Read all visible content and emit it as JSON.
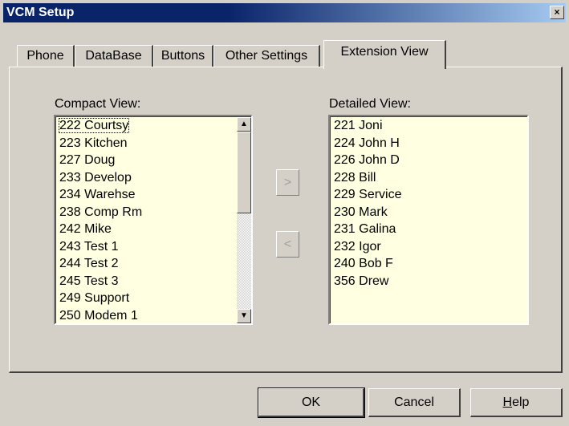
{
  "window": {
    "title": "VCM Setup",
    "close_glyph": "×"
  },
  "tabs": [
    {
      "label": "Phone"
    },
    {
      "label": "DataBase"
    },
    {
      "label": "Buttons"
    },
    {
      "label": "Other Settings"
    },
    {
      "label": "Extension View",
      "active": true
    }
  ],
  "compact": {
    "label": "Compact View:",
    "items": [
      "222 Courtsy",
      "223 Kitchen",
      "227 Doug",
      "233 Develop",
      "234 Warehse",
      "238 Comp Rm",
      "242 Mike",
      "243 Test 1",
      "244 Test 2",
      "245 Test 3",
      "249 Support",
      "250 Modem 1"
    ],
    "scroll_up_glyph": "▲",
    "scroll_down_glyph": "▼"
  },
  "detailed": {
    "label": "Detailed View:",
    "items": [
      "221 Joni",
      "224 John H",
      "226 John D",
      "228 Bill",
      "229 Service",
      "230 Mark",
      "231 Galina",
      "232 Igor",
      "240 Bob F",
      "356 Drew"
    ]
  },
  "move": {
    "right_label": ">",
    "left_label": "<"
  },
  "buttons": {
    "ok": "OK",
    "cancel": "Cancel",
    "help_underlined": "H",
    "help_rest": "elp"
  },
  "colors": {
    "list_bg": "#ffffe1",
    "face": "#d4d0c8",
    "title_bg": "#0a246a"
  }
}
